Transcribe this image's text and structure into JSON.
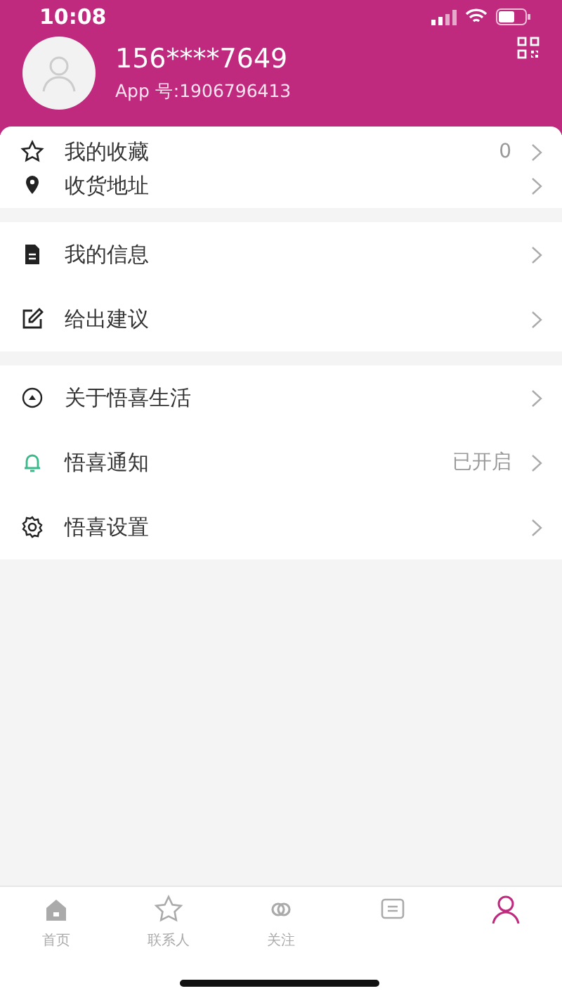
{
  "status_bar": {
    "time": "10:08"
  },
  "profile": {
    "phone": "156****7649",
    "app_id": "App 号:1906796413"
  },
  "groups": [
    {
      "items": [
        {
          "label": "我的收藏",
          "value": "0"
        },
        {
          "label": "收货地址"
        }
      ]
    },
    {
      "items": [
        {
          "label": "我的信息"
        },
        {
          "label": "给出建议"
        }
      ]
    },
    {
      "items": [
        {
          "label": "关于悟喜生活"
        },
        {
          "label": "悟喜通知",
          "value": "已开启"
        },
        {
          "label": "悟喜设置"
        }
      ]
    }
  ],
  "tab_bar": [
    {
      "label": "首页",
      "selected": false
    },
    {
      "label": "联系人",
      "selected": false
    },
    {
      "label": "关注",
      "selected": false
    },
    {
      "selected": false
    },
    {
      "selected": true
    }
  ]
}
